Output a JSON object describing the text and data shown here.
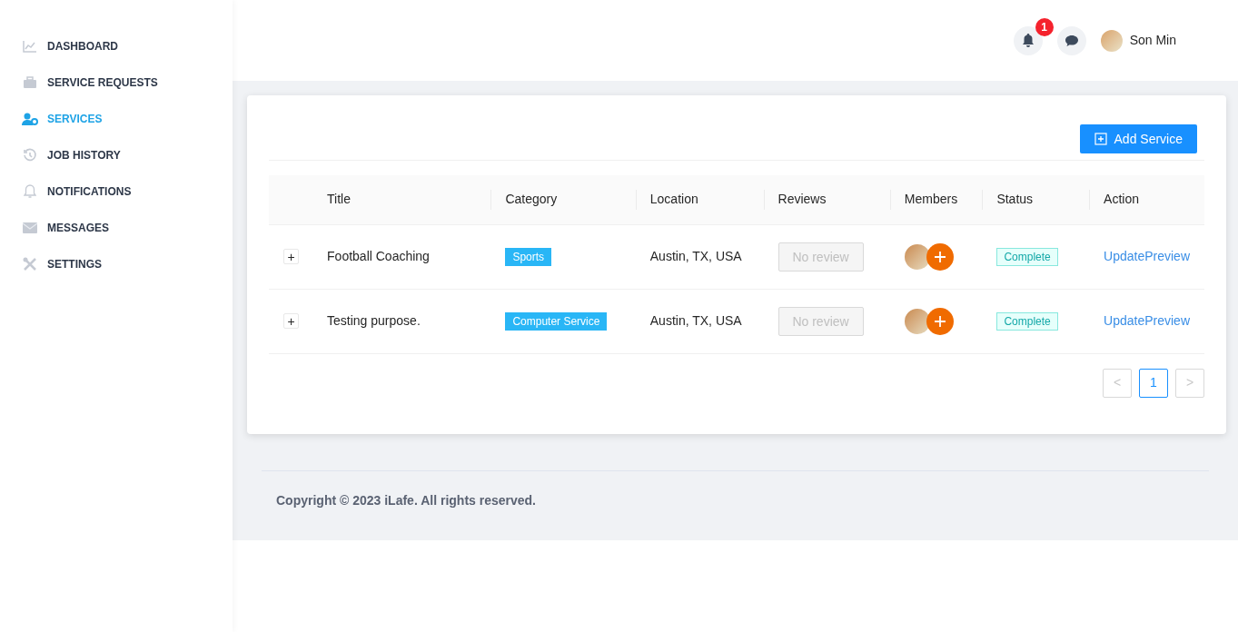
{
  "sidebar": {
    "items": [
      {
        "label": "DASHBOARD",
        "selected": false
      },
      {
        "label": "SERVICE REQUESTS",
        "selected": false
      },
      {
        "label": "SERVICES",
        "selected": true
      },
      {
        "label": "JOB HISTORY",
        "selected": false
      },
      {
        "label": "NOTIFICATIONS",
        "selected": false
      },
      {
        "label": "MESSAGES",
        "selected": false
      },
      {
        "label": "SETTINGS",
        "selected": false
      }
    ]
  },
  "header": {
    "notification_count": "1",
    "user_name": "Son Min"
  },
  "toolbar": {
    "add_button": "Add Service"
  },
  "table": {
    "columns": [
      "Title",
      "Category",
      "Location",
      "Reviews",
      "Members",
      "Status",
      "Action"
    ],
    "rows": [
      {
        "expand": "+",
        "title": "Football Coaching",
        "category": "Sports",
        "location": "Austin, TX, USA",
        "reviews": "No review",
        "status": "Complete",
        "actions": [
          "Update",
          "Preview"
        ]
      },
      {
        "expand": "+",
        "title": "Testing purpose.",
        "category": "Computer Service",
        "location": "Austin, TX, USA",
        "reviews": "No review",
        "status": "Complete",
        "actions": [
          "Update",
          "Preview"
        ]
      }
    ]
  },
  "pagination": {
    "prev": "<",
    "pages": [
      {
        "label": "1",
        "selected": true
      }
    ],
    "next": ">"
  },
  "footer": {
    "text": "Copyright © 2023 iLafe. All rights reserved."
  }
}
